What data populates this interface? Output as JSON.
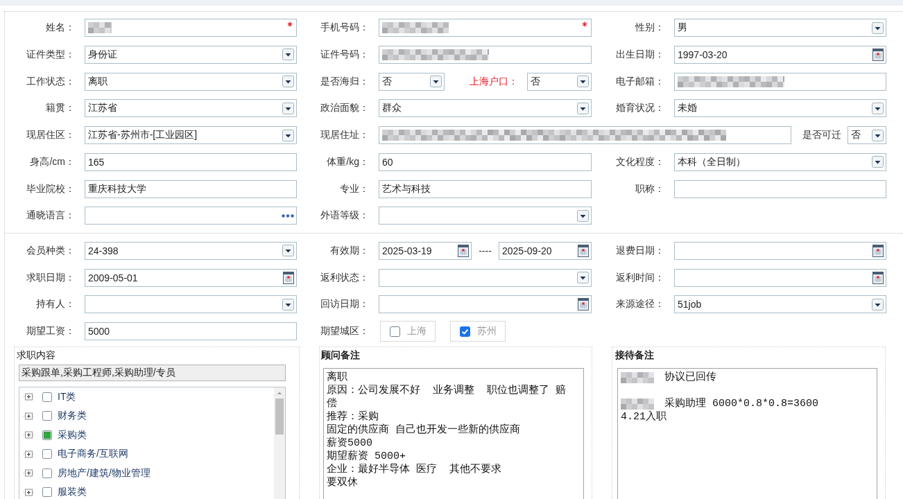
{
  "personal_section": {
    "rows": [
      {
        "cells": [
          {
            "kind": "field",
            "label": "姓名：",
            "control": {
              "kind": "text",
              "redacted": true,
              "required": true
            }
          },
          {
            "kind": "field",
            "label": "手机号码：",
            "control": {
              "kind": "text",
              "redacted": true,
              "required": true
            }
          },
          {
            "kind": "field",
            "label": "性别：",
            "control": {
              "kind": "select",
              "value": "男"
            }
          }
        ]
      },
      {
        "cells": [
          {
            "kind": "field",
            "label": "证件类型：",
            "control": {
              "kind": "select",
              "value": "身份证"
            }
          },
          {
            "kind": "field",
            "label": "证件号码：",
            "control": {
              "kind": "text",
              "redacted": true
            }
          },
          {
            "kind": "field",
            "label": "出生日期：",
            "control": {
              "kind": "date",
              "value": "1997-03-20"
            }
          }
        ]
      },
      {
        "cells": [
          {
            "kind": "field",
            "label": "工作状态：",
            "control": {
              "kind": "select",
              "value": "离职"
            }
          },
          {
            "kind": "pair",
            "label": "是否海归：",
            "control": {
              "kind": "select",
              "value": "否"
            },
            "second_label": {
              "text": "上海户口：",
              "highlight": true
            },
            "second_control": {
              "kind": "select",
              "value": "否"
            }
          },
          {
            "kind": "field",
            "label": "电子邮箱：",
            "control": {
              "kind": "text",
              "redacted": true
            }
          }
        ]
      },
      {
        "cells": [
          {
            "kind": "field",
            "label": "籍贯：",
            "control": {
              "kind": "select",
              "value": "江苏省"
            }
          },
          {
            "kind": "field",
            "label": "政治面貌：",
            "control": {
              "kind": "select",
              "value": "群众"
            }
          },
          {
            "kind": "field",
            "label": "婚育状况：",
            "control": {
              "kind": "select",
              "value": "未婚"
            }
          }
        ]
      },
      {
        "cells": [
          {
            "kind": "field",
            "label": "现居住区：",
            "control": {
              "kind": "select",
              "value": "江苏省-苏州市-[工业园区]"
            }
          },
          {
            "kind": "wide",
            "label": "现居住址：",
            "control": {
              "kind": "text",
              "redacted": true
            },
            "side_label": "是否可迁",
            "side_control": {
              "kind": "select",
              "value": "否"
            }
          }
        ]
      },
      {
        "cells": [
          {
            "kind": "field",
            "label": "身高/cm：",
            "control": {
              "kind": "text",
              "value": "165"
            }
          },
          {
            "kind": "field",
            "label": "体重/kg：",
            "control": {
              "kind": "text",
              "value": "60"
            }
          },
          {
            "kind": "field",
            "label": "文化程度：",
            "control": {
              "kind": "select",
              "value": "本科（全日制）"
            }
          }
        ]
      },
      {
        "cells": [
          {
            "kind": "field",
            "label": "毕业院校：",
            "control": {
              "kind": "text",
              "value": "重庆科技大学"
            }
          },
          {
            "kind": "field",
            "label": "专业：",
            "control": {
              "kind": "text",
              "value": "艺术与科技"
            }
          },
          {
            "kind": "field",
            "label": "职称：",
            "control": {
              "kind": "text"
            }
          }
        ]
      },
      {
        "cells": [
          {
            "kind": "field",
            "label": "通晓语言：",
            "control": {
              "kind": "picker"
            }
          },
          {
            "kind": "field",
            "label": "外语等级：",
            "control": {
              "kind": "select"
            }
          }
        ]
      }
    ]
  },
  "business_section": {
    "rows": [
      {
        "cells": [
          {
            "kind": "field",
            "label": "会员种类：",
            "control": {
              "kind": "select",
              "value": "24-398"
            }
          },
          {
            "kind": "range",
            "label": "有效期：",
            "start": {
              "kind": "date",
              "value": "2025-03-19"
            },
            "separator": "----",
            "end": {
              "kind": "date",
              "value": "2025-09-20"
            }
          },
          {
            "kind": "field",
            "label": "退费日期：",
            "control": {
              "kind": "date"
            }
          }
        ]
      },
      {
        "cells": [
          {
            "kind": "field",
            "label": "求职日期：",
            "control": {
              "kind": "date",
              "value": "2009-05-01"
            }
          },
          {
            "kind": "field",
            "label": "返利状态：",
            "control": {
              "kind": "select"
            }
          },
          {
            "kind": "field",
            "label": "返利时间：",
            "control": {
              "kind": "date"
            }
          }
        ]
      },
      {
        "cells": [
          {
            "kind": "field",
            "label": "持有人：",
            "control": {
              "kind": "select"
            }
          },
          {
            "kind": "field",
            "label": "回访日期：",
            "control": {
              "kind": "date"
            }
          },
          {
            "kind": "field",
            "label": "来源途径：",
            "control": {
              "kind": "select",
              "value": "51job"
            }
          }
        ]
      },
      {
        "cells": [
          {
            "kind": "field",
            "label": "期望工资：",
            "control": {
              "kind": "text",
              "value": "5000"
            }
          },
          {
            "kind": "options",
            "label": "期望城区：",
            "options": [
              {
                "label": "上海",
                "checked": false
              },
              {
                "label": "苏州",
                "checked": true
              }
            ]
          }
        ]
      }
    ]
  },
  "job_intent": {
    "title": "求职内容",
    "title_bold": false,
    "summary": "采购跟单,采购工程师,采购助理/专员",
    "categories": [
      {
        "label": "IT类",
        "expanded": false,
        "checked": false,
        "partial": false
      },
      {
        "label": "财务类",
        "expanded": false,
        "checked": false,
        "partial": false
      },
      {
        "label": "采购类",
        "expanded": false,
        "checked": false,
        "partial": true
      },
      {
        "label": "电子商务/互联网",
        "expanded": false,
        "checked": false,
        "partial": false
      },
      {
        "label": "房地产/建筑/物业管理",
        "expanded": false,
        "checked": false,
        "partial": false
      },
      {
        "label": "服装类",
        "expanded": false,
        "checked": false,
        "partial": false
      }
    ]
  },
  "advisor_notes": {
    "title": "顾问备注",
    "title_bold": true,
    "lines": [
      "离职",
      "原因：公司发展不好  业务调整  职位也调整了 赔",
      "偿",
      "推荐：采购",
      "固定的供应商 自己也开发一些新的供应商",
      "薪资5000",
      "期望薪资 5000+",
      "企业：最好半导体 医疗  其他不要求",
      "要双休"
    ]
  },
  "reception_notes": {
    "title": "接待备注",
    "title_bold": true,
    "lines": [
      {
        "redacted": true,
        "text": "协议已回传"
      },
      {
        "redacted": true,
        "blank_before": true,
        "text": "采购助理 6000*0.8*0.8=3600"
      },
      {
        "text": "4.21入职"
      }
    ]
  }
}
